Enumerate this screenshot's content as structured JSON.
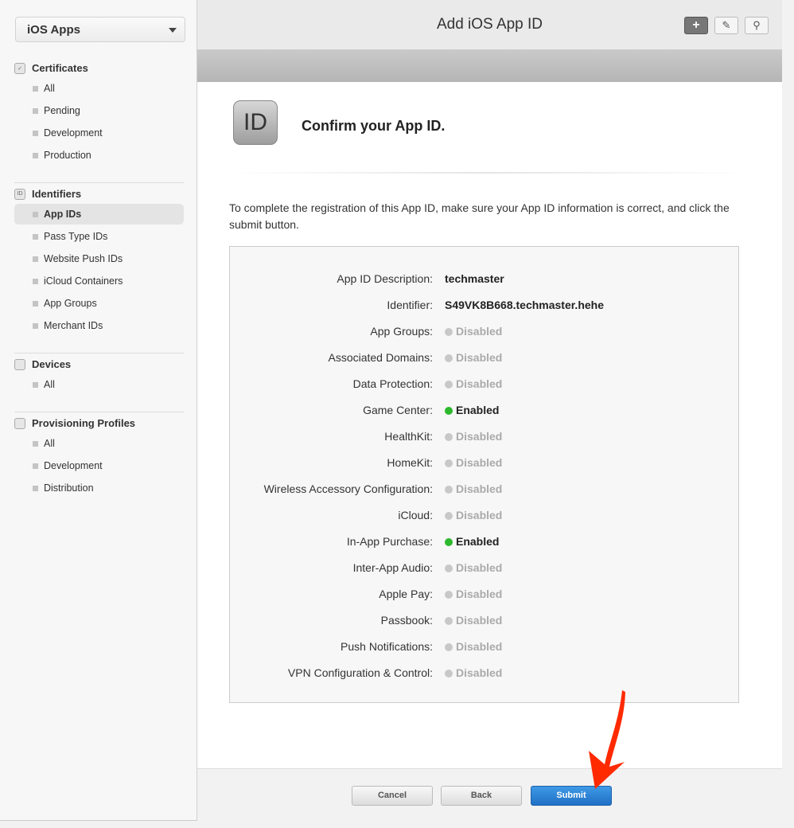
{
  "sidebar": {
    "selector": "iOS Apps",
    "sections": [
      {
        "title": "Certificates",
        "icon": "certificate-icon",
        "items": [
          "All",
          "Pending",
          "Development",
          "Production"
        ]
      },
      {
        "title": "Identifiers",
        "icon": "id-icon",
        "items": [
          "App IDs",
          "Pass Type IDs",
          "Website Push IDs",
          "iCloud Containers",
          "App Groups",
          "Merchant IDs"
        ]
      },
      {
        "title": "Devices",
        "icon": "device-icon",
        "items": [
          "All"
        ]
      },
      {
        "title": "Provisioning Profiles",
        "icon": "document-icon",
        "items": [
          "All",
          "Development",
          "Distribution"
        ]
      }
    ],
    "active_item": "App IDs"
  },
  "header": {
    "title": "Add iOS App ID",
    "toolbar": [
      "plus-icon",
      "edit-icon",
      "search-icon"
    ]
  },
  "content": {
    "icon_text": "ID",
    "title": "Confirm your App ID.",
    "intro": "To complete the registration of this App ID, make sure your App ID information is correct, and click the submit button.",
    "rows": [
      {
        "label": "App ID Description:",
        "value": "techmaster"
      },
      {
        "label": "Identifier:",
        "value": "S49VK8B668.techmaster.hehe"
      },
      {
        "label": "App Groups:",
        "value": "Disabled",
        "status": "disabled"
      },
      {
        "label": "Associated Domains:",
        "value": "Disabled",
        "status": "disabled"
      },
      {
        "label": "Data Protection:",
        "value": "Disabled",
        "status": "disabled"
      },
      {
        "label": "Game Center:",
        "value": "Enabled",
        "status": "enabled"
      },
      {
        "label": "HealthKit:",
        "value": "Disabled",
        "status": "disabled"
      },
      {
        "label": "HomeKit:",
        "value": "Disabled",
        "status": "disabled"
      },
      {
        "label": "Wireless Accessory Configuration:",
        "value": "Disabled",
        "status": "disabled"
      },
      {
        "label": "iCloud:",
        "value": "Disabled",
        "status": "disabled"
      },
      {
        "label": "In-App Purchase:",
        "value": "Enabled",
        "status": "enabled"
      },
      {
        "label": "Inter-App Audio:",
        "value": "Disabled",
        "status": "disabled"
      },
      {
        "label": "Apple Pay:",
        "value": "Disabled",
        "status": "disabled"
      },
      {
        "label": "Passbook:",
        "value": "Disabled",
        "status": "disabled"
      },
      {
        "label": "Push Notifications:",
        "value": "Disabled",
        "status": "disabled"
      },
      {
        "label": "VPN Configuration & Control:",
        "value": "Disabled",
        "status": "disabled"
      }
    ]
  },
  "footer": {
    "cancel": "Cancel",
    "back": "Back",
    "submit": "Submit"
  },
  "colors": {
    "enabled": "#2db82d",
    "disabled": "#c8c8c8",
    "submit": "#2a82d6",
    "arrow": "#ff2a00"
  }
}
